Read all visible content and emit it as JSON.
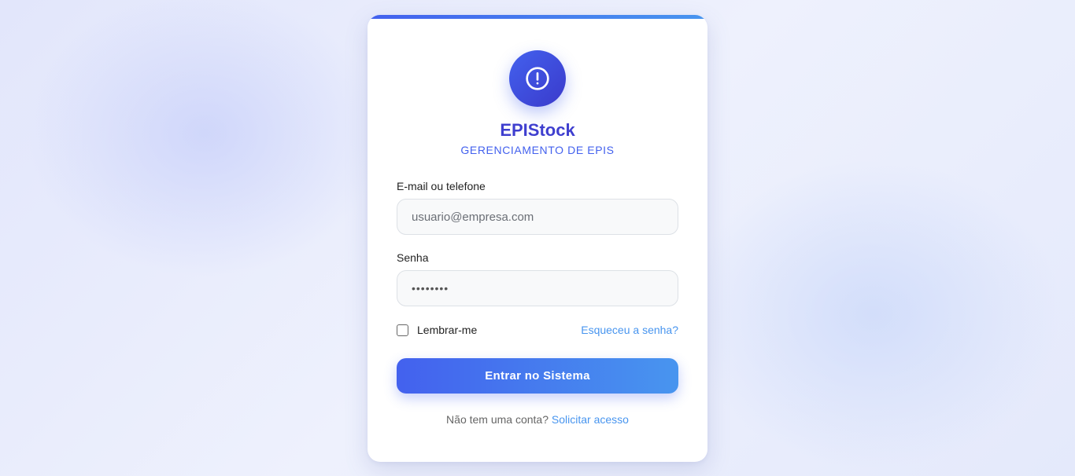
{
  "brand": {
    "title": "EPIStock",
    "subtitle": "GERENCIAMENTO DE EPIS",
    "icon": "alert-circle-icon"
  },
  "form": {
    "email_label": "E-mail ou telefone",
    "email_placeholder": "usuario@empresa.com",
    "email_value": "",
    "password_label": "Senha",
    "password_value": "••••••••",
    "remember_label": "Lembrar-me",
    "remember_checked": false,
    "forgot_link": "Esqueceu a senha?",
    "submit_label": "Entrar no Sistema"
  },
  "footer": {
    "text": "Não tem uma conta?",
    "link": "Solicitar acesso"
  },
  "colors": {
    "primary": "#4361ee",
    "accent": "#4895ef",
    "brand_title": "#3f3fcf"
  }
}
